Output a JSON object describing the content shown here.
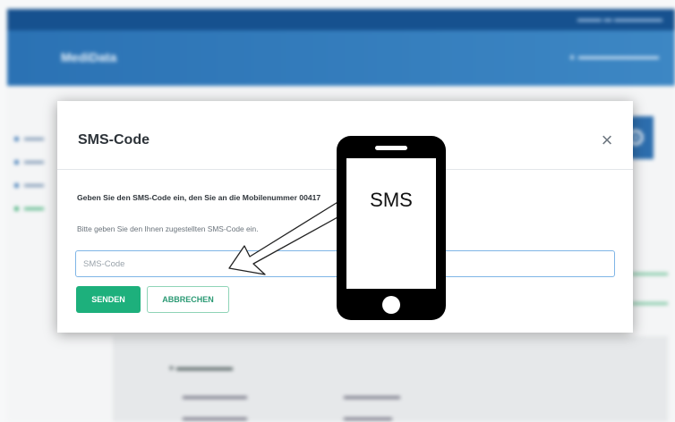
{
  "background_app": {
    "logo": "MediData"
  },
  "modal": {
    "title": "SMS-Code",
    "close_symbol": "×",
    "instruction": "Geben Sie den SMS-Code ein, den Sie an die Mobilenummer 00417",
    "helper": "Bitte geben Sie den Ihnen zugestellten SMS-Code ein.",
    "input": {
      "placeholder": "SMS-Code",
      "value": ""
    },
    "buttons": {
      "send": "SENDEN",
      "cancel": "ABBRECHEN"
    }
  },
  "overlay": {
    "phone_label": "SMS"
  },
  "colors": {
    "primary_blue": "#2b72b4",
    "send_green": "#1db07c",
    "input_focus": "#7fb5e6"
  },
  "icons": [
    "close-icon",
    "gear-icon",
    "phone-icon",
    "arrow-icon"
  ]
}
